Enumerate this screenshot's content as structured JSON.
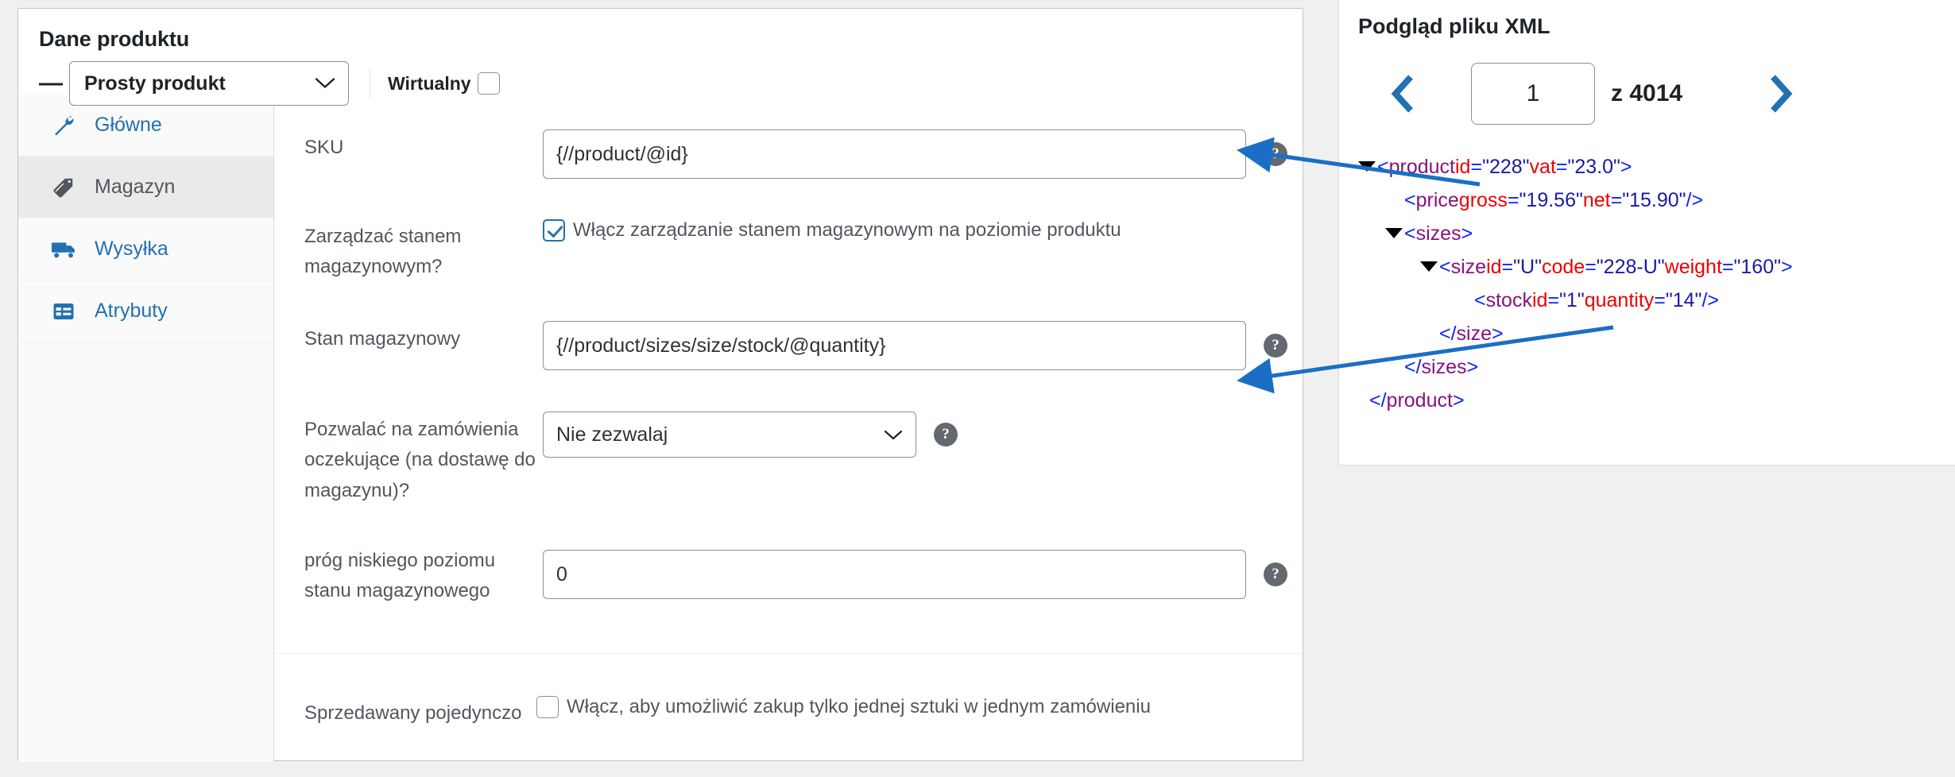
{
  "product_data": {
    "title": "Dane produktu",
    "collapse_icon": "minus-icon",
    "type_select": {
      "value": "Prosty produkt",
      "chevron": "chevron-down-icon"
    },
    "virtual": {
      "label": "Wirtualny",
      "checked": false
    }
  },
  "tabs": [
    {
      "id": "glowne",
      "label": "Główne",
      "icon": "wrench-icon",
      "active": false
    },
    {
      "id": "magazyn",
      "label": "Magazyn",
      "icon": "tag-icon",
      "active": true
    },
    {
      "id": "wysylka",
      "label": "Wysyłka",
      "icon": "truck-icon",
      "active": false
    },
    {
      "id": "atrybuty",
      "label": "Atrybuty",
      "icon": "list-icon",
      "active": false
    }
  ],
  "fields": {
    "sku": {
      "label": "SKU",
      "value": "{//product/@id}",
      "help": "?"
    },
    "manage_stock": {
      "label": "Zarządzać stanem magazynowym?",
      "checkbox_label": "Włącz zarządzanie stanem magazynowym na poziomie produktu",
      "checked": true
    },
    "stock_quantity": {
      "label": "Stan magazynowy",
      "value": "{//product/sizes/size/stock/@quantity}",
      "help": "?"
    },
    "backorders": {
      "label": "Pozwalać na zamówienia oczekujące (na dostawę do magazynu)?",
      "value": "Nie zezwalaj",
      "chevron": "chevron-down-icon",
      "help": "?"
    },
    "low_stock_threshold": {
      "label": "próg niskiego poziomu stanu magazynowego",
      "value": "0",
      "help": "?"
    },
    "sold_individually": {
      "label": "Sprzedawany pojedynczo",
      "checkbox_label": "Włącz, aby umożliwić zakup tylko jednej sztuki w jednym zamówieniu",
      "checked": false
    }
  },
  "xml_preview": {
    "title": "Podgląd pliku XML",
    "prev_icon": "chevron-left-icon",
    "next_icon": "chevron-right-icon",
    "page": "1",
    "total_label": "z 4014",
    "lines": [
      {
        "indent": 0,
        "triangle": true,
        "text": "<product id=\"228\" vat=\"23.0\">"
      },
      {
        "indent": 1,
        "triangle": false,
        "text": "<price gross=\"19.56\" net=\"15.90\"/>"
      },
      {
        "indent": 1,
        "triangle": true,
        "text": "<sizes>"
      },
      {
        "indent": 2,
        "triangle": true,
        "text": "<size id=\"U\" code=\"228-U\" weight=\"160\">"
      },
      {
        "indent": 3,
        "triangle": false,
        "text": "<stock id=\"1\" quantity=\"14\"/>"
      },
      {
        "indent": 2,
        "triangle": false,
        "text": "</size>"
      },
      {
        "indent": 1,
        "triangle": false,
        "text": "</sizes>"
      },
      {
        "indent": 0,
        "triangle": false,
        "text": "</product>"
      }
    ]
  },
  "colors": {
    "accent": "#2271b1",
    "tag": "#881280",
    "bracket": "#0b24fb",
    "attribute": "#ee0000",
    "value": "#1a1aa6",
    "arrow": "#1a6fc4"
  },
  "annotations": [
    {
      "id": "sku-arrow",
      "from": "product-id-attribute",
      "to": "sku-input"
    },
    {
      "id": "stock-arrow",
      "from": "stock-quantity-attribute",
      "to": "stock-quantity-input"
    }
  ]
}
